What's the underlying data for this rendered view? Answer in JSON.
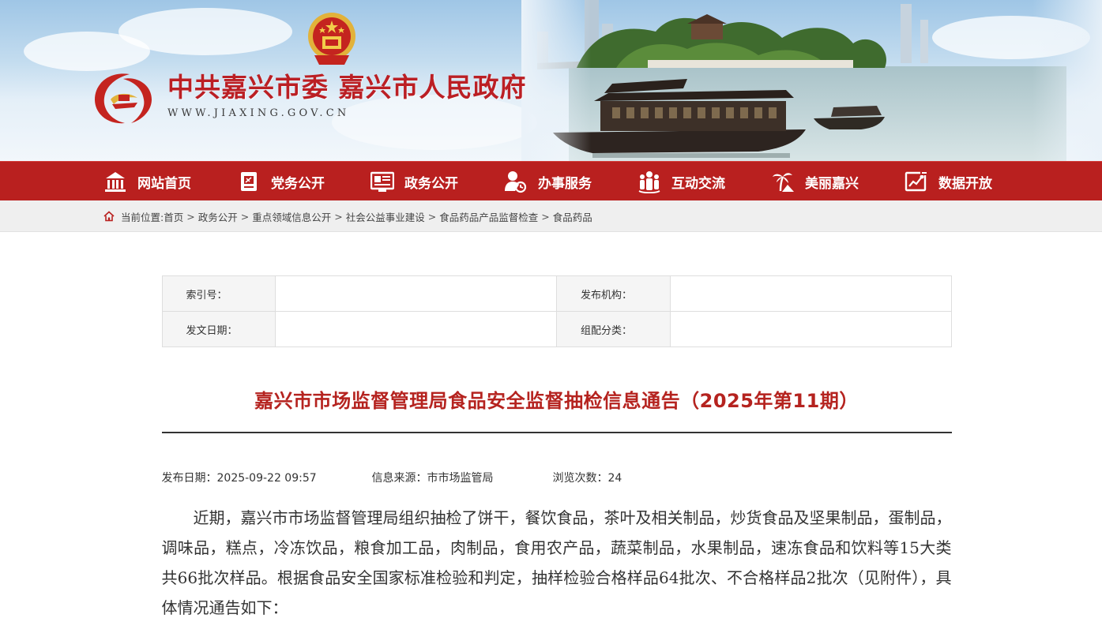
{
  "header": {
    "site_title": "中共嘉兴市委 嘉兴市人民政府",
    "site_url": "WWW.JIAXING.GOV.CN"
  },
  "nav": {
    "items": [
      {
        "label": "网站首页",
        "icon": "building-icon"
      },
      {
        "label": "党务公开",
        "icon": "party-flag-icon"
      },
      {
        "label": "政务公开",
        "icon": "document-board-icon"
      },
      {
        "label": "办事服务",
        "icon": "user-service-icon"
      },
      {
        "label": "互动交流",
        "icon": "people-group-icon"
      },
      {
        "label": "美丽嘉兴",
        "icon": "palm-tree-icon"
      },
      {
        "label": "数据开放",
        "icon": "data-chart-icon"
      }
    ]
  },
  "breadcrumb": {
    "prefix": "当前位置:",
    "items": [
      "首页",
      "政务公开",
      "重点领域信息公开",
      "社会公益事业建设",
      "食品药品产品监督检查",
      "食品药品"
    ],
    "separator": ">"
  },
  "meta": {
    "index_label": "索引号：",
    "index_value": "",
    "publisher_label": "发布机构：",
    "publisher_value": "",
    "date_label": "发文日期：",
    "date_value": "",
    "category_label": "组配分类：",
    "category_value": ""
  },
  "article": {
    "title": "嘉兴市市场监督管理局食品安全监督抽检信息通告（2025年第11期）",
    "publish_date": "发布日期：2025-09-22 09:57",
    "source": "信息来源：市市场监管局",
    "views": "浏览次数：24",
    "paragraph": "近期，嘉兴市市场监督管理局组织抽检了饼干，餐饮食品，茶叶及相关制品，炒货食品及坚果制品，蛋制品，调味品，糕点，冷冻饮品，粮食加工品，肉制品，食用农产品，蔬菜制品，水果制品，速冻食品和饮料等15大类共66批次样品。根据食品安全国家标准检验和判定，抽样检验合格样品64批次、不合格样品2批次（见附件），具体情况通告如下："
  },
  "colors": {
    "brand_red": "#b9201f",
    "title_red": "#b5231f",
    "crumb_bg": "#efefef"
  }
}
